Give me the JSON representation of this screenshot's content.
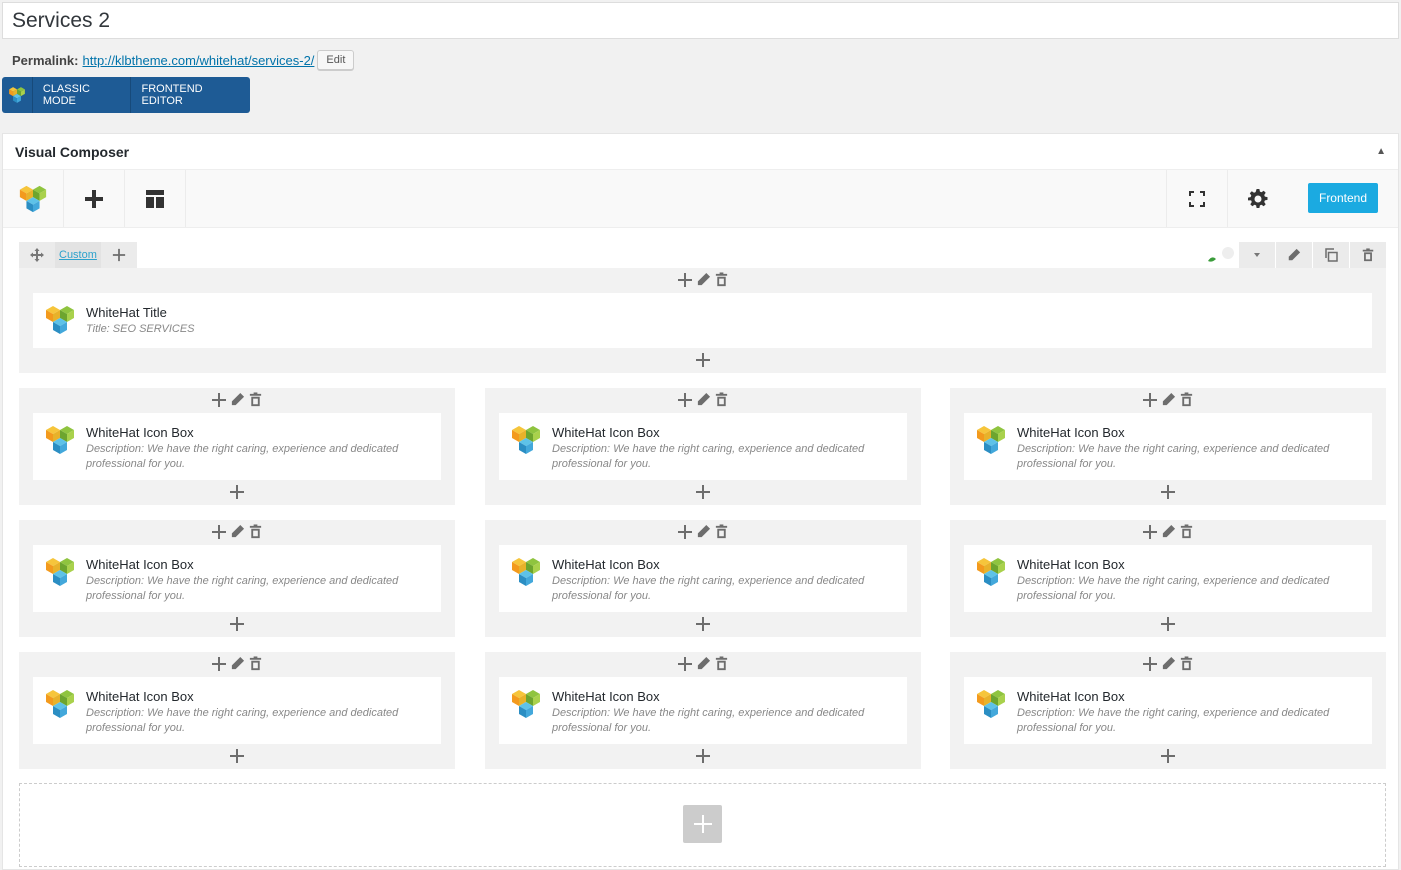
{
  "post": {
    "title": "Services 2",
    "permalink_label": "Permalink:",
    "permalink_url": "http://klbtheme.com/whitehat/services-2/",
    "edit_label": "Edit"
  },
  "mode_bar": {
    "classic_label": "CLASSIC MODE",
    "frontend_label": "FRONTEND EDITOR"
  },
  "composer": {
    "title": "Visual Composer",
    "frontend_button": "Frontend",
    "row_layout_label": "Custom"
  },
  "title_element": {
    "name": "WhiteHat Title",
    "desc": "Title: SEO SERVICES"
  },
  "icon_boxes": [
    {
      "name": "WhiteHat Icon Box",
      "desc": "Description: We have the right caring, experience and dedicated professional for you."
    },
    {
      "name": "WhiteHat Icon Box",
      "desc": "Description: We have the right caring, experience and dedicated professional for you."
    },
    {
      "name": "WhiteHat Icon Box",
      "desc": "Description: We have the right caring, experience and dedicated professional for you."
    },
    {
      "name": "WhiteHat Icon Box",
      "desc": "Description: We have the right caring, experience and dedicated professional for you."
    },
    {
      "name": "WhiteHat Icon Box",
      "desc": "Description: We have the right caring, experience and dedicated professional for you."
    },
    {
      "name": "WhiteHat Icon Box",
      "desc": "Description: We have the right caring, experience and dedicated professional for you."
    },
    {
      "name": "WhiteHat Icon Box",
      "desc": "Description: We have the right caring, experience and dedicated professional for you."
    },
    {
      "name": "WhiteHat Icon Box",
      "desc": "Description: We have the right caring, experience and dedicated professional for you."
    },
    {
      "name": "WhiteHat Icon Box",
      "desc": "Description: We have the right caring, experience and dedicated professional for you."
    }
  ],
  "colors": {
    "accent": "#1baae1",
    "mode_bar": "#1e5b95",
    "link": "#0073aa"
  }
}
